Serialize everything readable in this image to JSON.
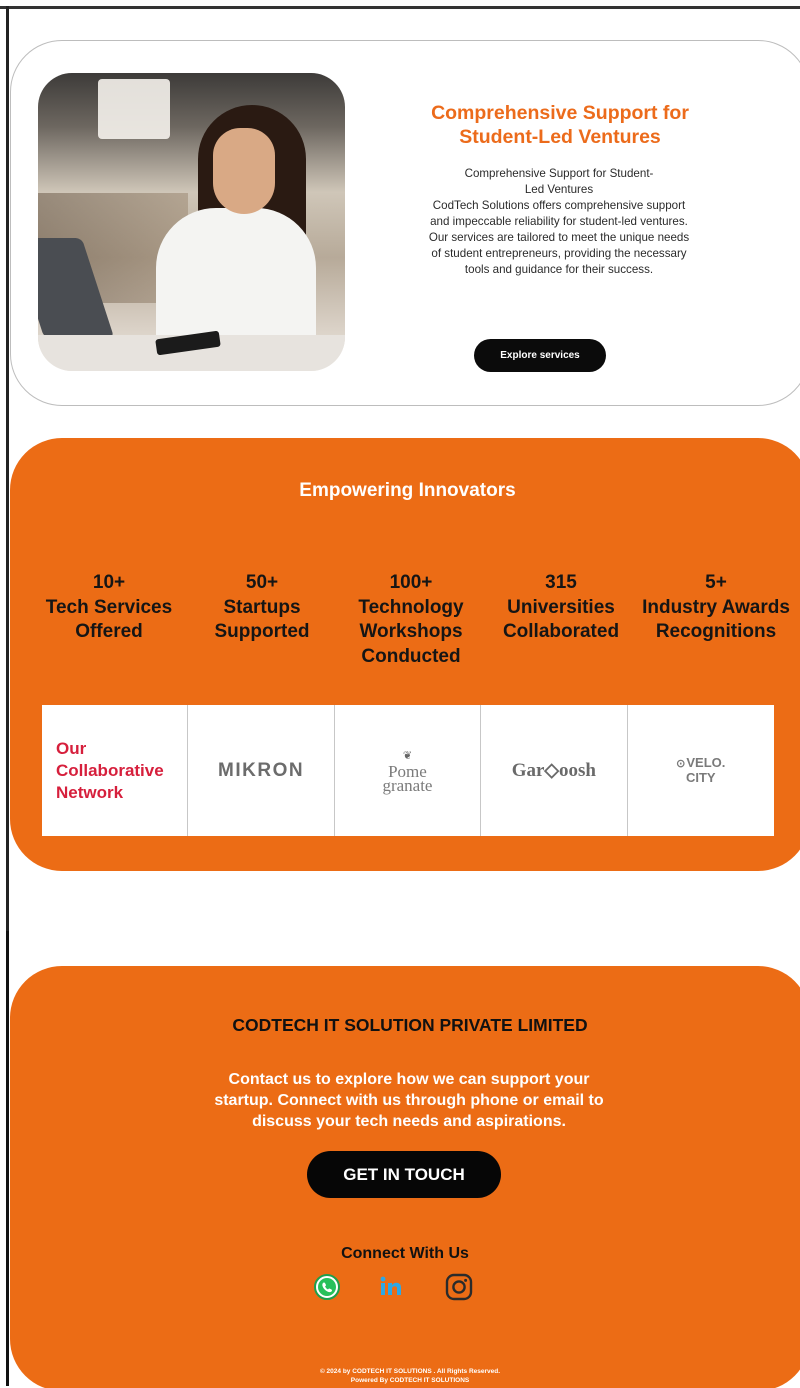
{
  "hero": {
    "title": "Comprehensive Support for Student-Led Ventures",
    "body_line1": "Comprehensive Support for Student-",
    "body_line2": "Led Ventures",
    "body_rest": "CodTech Solutions offers comprehensive support and impeccable reliability for student-led ventures. Our services are tailored to meet the unique needs of student entrepreneurs, providing the necessary tools and guidance for their success.",
    "button_label": "Explore services"
  },
  "stats": {
    "title": "Empowering Innovators",
    "items": [
      {
        "value": "10+",
        "label1": "Tech Services",
        "label2": "Offered",
        "label3": ""
      },
      {
        "value": "50+",
        "label1": "Startups",
        "label2": "Supported",
        "label3": ""
      },
      {
        "value": "100+",
        "label1": "Technology",
        "label2": "Workshops",
        "label3": "Conducted"
      },
      {
        "value": "315",
        "label1": "Universities",
        "label2": "Collaborated",
        "label3": ""
      },
      {
        "value": "5+",
        "label1": "Industry Awards",
        "label2": "Recognitions",
        "label3": ""
      }
    ]
  },
  "network": {
    "label_line1": "Our",
    "label_line2": "Collaborative",
    "label_line3": "Network",
    "logos": {
      "mikron": "MIKRON",
      "pome_line1": "Pome",
      "pome_line2": "granate",
      "garoosh": "Gar◇oosh",
      "velo_line1": "VELO.",
      "velo_line2": "CITY"
    }
  },
  "footer": {
    "company": "CODTECH IT SOLUTION PRIVATE LIMITED",
    "contact_text": "Contact us to explore how we can support your startup. Connect with us through phone or email to discuss your tech needs and aspirations.",
    "cta_label": "GET IN TOUCH",
    "connect_label": "Connect With Us",
    "social": [
      "whatsapp-icon",
      "linkedin-icon",
      "instagram-icon"
    ],
    "copyright_line1": "© 2024 by CODTECH IT SOLUTIONS . All Rights Reserved.",
    "copyright_line2": "Powered By CODTECH IT SOLUTIONS"
  },
  "colors": {
    "accent": "#ec6c15",
    "title_orange": "#ec6b1b",
    "network_red": "#d61f3c",
    "button_black": "#0b0b0b"
  }
}
